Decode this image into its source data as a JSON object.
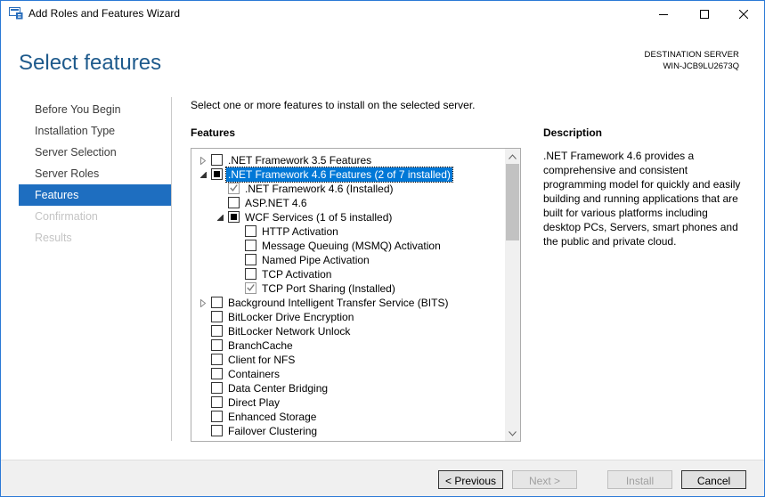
{
  "window": {
    "title": "Add Roles and Features Wizard",
    "minimize_glyph": "—",
    "maximize_glyph": "☐",
    "close_glyph": "✕"
  },
  "header": {
    "page_title": "Select features",
    "destination_label": "DESTINATION SERVER",
    "destination_name": "WIN-JCB9LU2673Q"
  },
  "nav": {
    "items": [
      {
        "label": "Before You Begin",
        "state": "normal"
      },
      {
        "label": "Installation Type",
        "state": "normal"
      },
      {
        "label": "Server Selection",
        "state": "normal"
      },
      {
        "label": "Server Roles",
        "state": "normal"
      },
      {
        "label": "Features",
        "state": "active"
      },
      {
        "label": "Confirmation",
        "state": "disabled"
      },
      {
        "label": "Results",
        "state": "disabled"
      }
    ]
  },
  "main": {
    "instruction": "Select one or more features to install on the selected server.",
    "features_heading": "Features",
    "features": [
      {
        "label": ".NET Framework 3.5 Features",
        "level": 0,
        "expander": "collapsed",
        "check": "unchecked"
      },
      {
        "label": ".NET Framework 4.6 Features (2 of 7 installed)",
        "level": 0,
        "expander": "expanded",
        "check": "partial",
        "selected": true
      },
      {
        "label": ".NET Framework 4.6 (Installed)",
        "level": 1,
        "expander": "none",
        "check": "checked-disabled"
      },
      {
        "label": "ASP.NET 4.6",
        "level": 1,
        "expander": "none",
        "check": "unchecked"
      },
      {
        "label": "WCF Services (1 of 5 installed)",
        "level": 1,
        "expander": "expanded",
        "check": "partial"
      },
      {
        "label": "HTTP Activation",
        "level": 2,
        "expander": "none",
        "check": "unchecked"
      },
      {
        "label": "Message Queuing (MSMQ) Activation",
        "level": 2,
        "expander": "none",
        "check": "unchecked"
      },
      {
        "label": "Named Pipe Activation",
        "level": 2,
        "expander": "none",
        "check": "unchecked"
      },
      {
        "label": "TCP Activation",
        "level": 2,
        "expander": "none",
        "check": "unchecked"
      },
      {
        "label": "TCP Port Sharing (Installed)",
        "level": 2,
        "expander": "none",
        "check": "checked-disabled"
      },
      {
        "label": "Background Intelligent Transfer Service (BITS)",
        "level": 0,
        "expander": "collapsed",
        "check": "unchecked"
      },
      {
        "label": "BitLocker Drive Encryption",
        "level": 0,
        "expander": "none",
        "check": "unchecked"
      },
      {
        "label": "BitLocker Network Unlock",
        "level": 0,
        "expander": "none",
        "check": "unchecked"
      },
      {
        "label": "BranchCache",
        "level": 0,
        "expander": "none",
        "check": "unchecked"
      },
      {
        "label": "Client for NFS",
        "level": 0,
        "expander": "none",
        "check": "unchecked"
      },
      {
        "label": "Containers",
        "level": 0,
        "expander": "none",
        "check": "unchecked"
      },
      {
        "label": "Data Center Bridging",
        "level": 0,
        "expander": "none",
        "check": "unchecked"
      },
      {
        "label": "Direct Play",
        "level": 0,
        "expander": "none",
        "check": "unchecked"
      },
      {
        "label": "Enhanced Storage",
        "level": 0,
        "expander": "none",
        "check": "unchecked"
      },
      {
        "label": "Failover Clustering",
        "level": 0,
        "expander": "none",
        "check": "unchecked"
      }
    ],
    "description_heading": "Description",
    "description_text": ".NET Framework 4.6 provides a comprehensive and consistent programming model for quickly and easily building and running applications that are built for various platforms including desktop PCs, Servers, smart phones and the public and private cloud."
  },
  "footer": {
    "previous_label": "< Previous",
    "next_label": "Next >",
    "install_label": "Install",
    "cancel_label": "Cancel"
  }
}
